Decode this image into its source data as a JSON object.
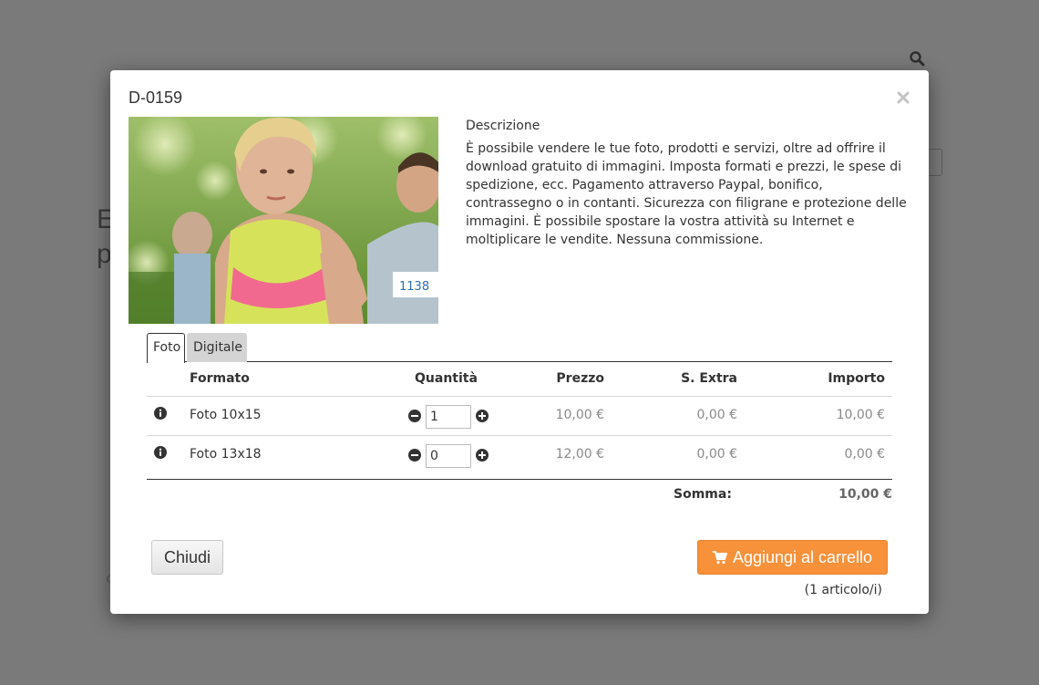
{
  "background": {
    "heading_line1": "E",
    "heading_line2": "p"
  },
  "modal": {
    "title": "D-0159",
    "photo_bib_number": "1138",
    "description": {
      "title": "Descrizione",
      "text": "È possibile vendere le tue foto, prodotti e servizi, oltre ad offrire il download gratuito di immagini. Imposta formati e prezzi, le spese di spedizione, ecc. Pagamento attraverso Paypal, bonifico, contrassegno o in contanti. Sicurezza con filigrane e protezione delle immagini. È possibile spostare la vostra attività su Internet e moltiplicare le vendite. Nessuna commissione."
    },
    "tabs": [
      {
        "label": "Foto",
        "active": true
      },
      {
        "label": "Digitale",
        "active": false
      }
    ],
    "table": {
      "headers": {
        "formato": "Formato",
        "quantita": "Quantità",
        "prezzo": "Prezzo",
        "extra": "S. Extra",
        "importo": "Importo"
      },
      "rows": [
        {
          "formato": "Foto 10x15",
          "quantita": "1",
          "prezzo": "10,00 €",
          "extra": "0,00 €",
          "importo": "10,00 €"
        },
        {
          "formato": "Foto 13x18",
          "quantita": "0",
          "prezzo": "12,00 €",
          "extra": "0,00 €",
          "importo": "0,00 €"
        }
      ],
      "sum_label": "Somma:",
      "sum_value": "10,00 €"
    },
    "close_label": "Chiudi",
    "add_to_cart_label": "Aggiungi al carrello",
    "items_count": "(1 articolo/i)"
  },
  "colors": {
    "overlay": "#7a7a7a",
    "accent": "#f7913a",
    "muted_price": "#8a8a8a"
  }
}
